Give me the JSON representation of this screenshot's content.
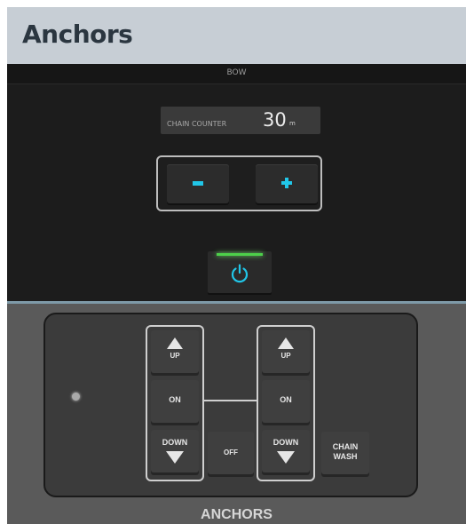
{
  "header": {
    "title": "Anchors"
  },
  "screen": {
    "section_label": "BOW",
    "chain_counter": {
      "label": "CHAIN COUNTER",
      "value": "30",
      "unit": "m"
    },
    "controls": {
      "minus_icon": "minus-icon",
      "plus_icon": "plus-icon",
      "power_icon": "power-icon"
    },
    "colors": {
      "accent": "#21c6e8",
      "led": "#4dd04a"
    }
  },
  "panel": {
    "left_group": {
      "up_label": "UP",
      "on_label": "ON",
      "down_label": "DOWN"
    },
    "right_group": {
      "up_label": "UP",
      "on_label": "ON",
      "down_label": "DOWN"
    },
    "off_label": "OFF",
    "chain_wash_label_1": "CHAIN",
    "chain_wash_label_2": "WASH",
    "footer_label": "ANCHORS"
  }
}
